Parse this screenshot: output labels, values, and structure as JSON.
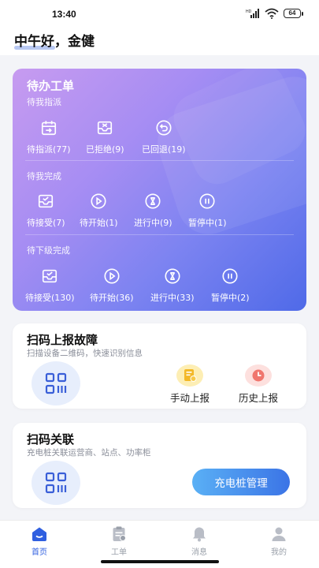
{
  "status": {
    "time": "13:40",
    "battery": "64"
  },
  "header": {
    "greeting": "中午好，金健"
  },
  "todo": {
    "title": "待办工单",
    "sections": [
      {
        "label": "待我指派",
        "items": [
          {
            "label": "待指派(77)",
            "icon": "calendar-assign-icon"
          },
          {
            "label": "已拒绝(9)",
            "icon": "reject-envelope-icon"
          },
          {
            "label": "已回退(19)",
            "icon": "return-icon"
          }
        ]
      },
      {
        "label": "待我完成",
        "items": [
          {
            "label": "待接受(7)",
            "icon": "accept-envelope-icon"
          },
          {
            "label": "待开始(1)",
            "icon": "play-icon"
          },
          {
            "label": "进行中(9)",
            "icon": "hourglass-icon"
          },
          {
            "label": "暂停中(1)",
            "icon": "pause-icon"
          }
        ]
      },
      {
        "label": "待下级完成",
        "items": [
          {
            "label": "待接受(130)",
            "icon": "accept-envelope-icon"
          },
          {
            "label": "待开始(36)",
            "icon": "play-icon"
          },
          {
            "label": "进行中(33)",
            "icon": "hourglass-icon"
          },
          {
            "label": "暂停中(2)",
            "icon": "pause-icon"
          }
        ]
      }
    ]
  },
  "scan_report": {
    "title": "扫码上报故障",
    "subtitle": "扫描设备二维码，快速识别信息",
    "manual_label": "手动上报",
    "history_label": "历史上报"
  },
  "scan_link": {
    "title": "扫码关联",
    "subtitle": "充电桩关联运营商、站点、功率柜",
    "button_label": "充电桩管理"
  },
  "tabbar": {
    "tabs": [
      {
        "label": "首页",
        "icon": "home-icon",
        "active": true
      },
      {
        "label": "工单",
        "icon": "clipboard-icon",
        "active": false
      },
      {
        "label": "消息",
        "icon": "bell-icon",
        "active": false
      },
      {
        "label": "我的",
        "icon": "user-icon",
        "active": false
      }
    ]
  },
  "colors": {
    "accent": "#2f5fe0",
    "card_gradient_start": "#c79bf0",
    "card_gradient_end": "#4f6ae8",
    "manual_icon_bg": "#fdeeb4",
    "history_icon_bg": "#fde0de"
  }
}
